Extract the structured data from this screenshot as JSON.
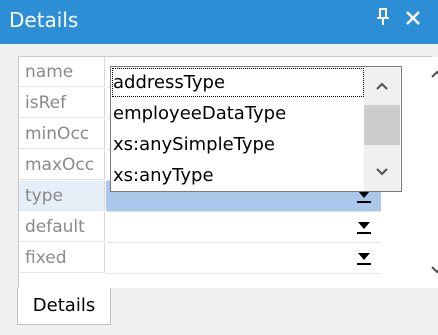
{
  "panel": {
    "title": "Details",
    "pin_glyph": "⍗",
    "close_glyph": "✕"
  },
  "grid": {
    "rows": [
      {
        "label": "name"
      },
      {
        "label": "isRef"
      },
      {
        "label": "minOcc"
      },
      {
        "label": "maxOcc"
      },
      {
        "label": "type"
      },
      {
        "label": "default"
      },
      {
        "label": "fixed"
      }
    ]
  },
  "dropdown": {
    "options": [
      "addressType",
      "employeeDataType",
      "xs:anySimpleType",
      "xs:anyType"
    ],
    "focused_index": 0
  },
  "tabs": [
    {
      "label": "Details"
    }
  ],
  "colors": {
    "titlebar": "#2c8fd6",
    "selection": "#aac8ec",
    "label_text": "#8a8a8a"
  },
  "icons": {
    "scroll_up": "⌃",
    "scroll_down": "⌄",
    "combo_arrow": "▼"
  }
}
